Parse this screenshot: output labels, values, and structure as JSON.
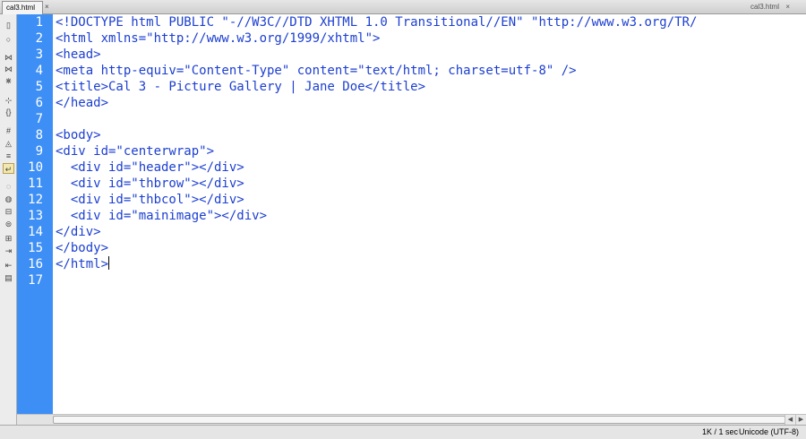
{
  "tab": {
    "filename": "cal3.html",
    "close_glyph": "×"
  },
  "path": {
    "filename": "cal3.html",
    "close_glyph": "×"
  },
  "toolbar": {
    "icons": [
      "document-icon",
      "stop-icon",
      "collapse-tag-icon",
      "collapse-selection-icon",
      "expand-all-icon",
      "select-parent-icon",
      "balance-braces-icon",
      "line-numbers-icon",
      "highlight-invalid-icon",
      "syntax-coloring-icon",
      "word-wrap-icon",
      "comment-icon",
      "uncomment-icon",
      "wrap-tag-icon",
      "recent-snippets-icon",
      "move-css-icon",
      "indent-icon",
      "outdent-icon",
      "format-source-icon"
    ],
    "active_index": 10
  },
  "editor": {
    "line_numbers": [
      "1",
      "2",
      "3",
      "4",
      "5",
      "6",
      "7",
      "8",
      "9",
      "10",
      "11",
      "12",
      "13",
      "14",
      "15",
      "16",
      "17"
    ],
    "lines": [
      "<!DOCTYPE html PUBLIC \"-//W3C//DTD XHTML 1.0 Transitional//EN\" \"http://www.w3.org/TR/",
      "<html xmlns=\"http://www.w3.org/1999/xhtml\">",
      "<head>",
      "<meta http-equiv=\"Content-Type\" content=\"text/html; charset=utf-8\" />",
      "<title>Cal 3 - Picture Gallery | Jane Doe</title>",
      "</head>",
      "",
      "<body>",
      "<div id=\"centerwrap\">",
      "  <div id=\"header\"></div>",
      "  <div id=\"thbrow\"></div>",
      "  <div id=\"thbcol\"></div>",
      "  <div id=\"mainimage\"></div>",
      "</div>",
      "</body>",
      "</html>",
      ""
    ],
    "caret_line": 16,
    "text_color": "#1c3fd1",
    "gutter_color": "#3d8ff5"
  },
  "scrollbar": {
    "left_arrow": "◀",
    "right_arrow": "▶"
  },
  "status": {
    "size": "1K / 1 sec",
    "encoding": "Unicode (UTF-8)"
  }
}
